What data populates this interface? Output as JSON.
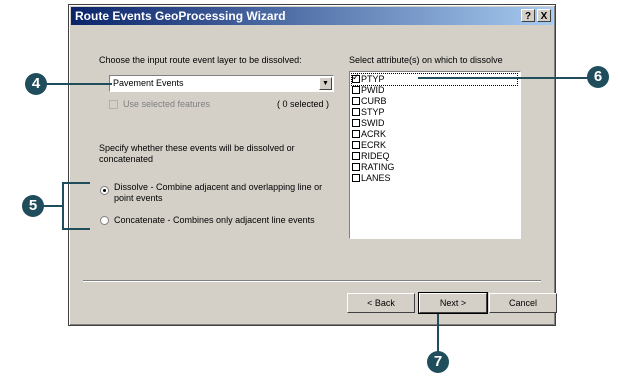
{
  "dialog": {
    "title": "Route Events GeoProcessing Wizard",
    "help_btn": "?",
    "close_btn": "X",
    "layer_prompt": "Choose the input route event layer to be dissolved:",
    "layer_value": "Pavement Events",
    "use_selected_label": "Use selected features",
    "selected_count": "( 0 selected )",
    "specify_text": "Specify whether these events will be dissolved or concatenated",
    "dissolve_label": "Dissolve - Combine adjacent and overlapping line or point events",
    "concatenate_label": "Concatenate - Combines only adjacent line events",
    "attributes_label": "Select attribute(s) on which to dissolve",
    "attributes": [
      "PTYP",
      "PWID",
      "CURB",
      "STYP",
      "SWID",
      "ACRK",
      "ECRK",
      "RIDEQ",
      "RATING",
      "LANES"
    ],
    "back_btn": "< Back",
    "next_btn": "Next >",
    "cancel_btn": "Cancel"
  },
  "callouts": {
    "c4": "4",
    "c5": "5",
    "c6": "6",
    "c7": "7"
  },
  "colors": {
    "callout": "#1f4d5c",
    "titlebar": "#0a246a"
  }
}
